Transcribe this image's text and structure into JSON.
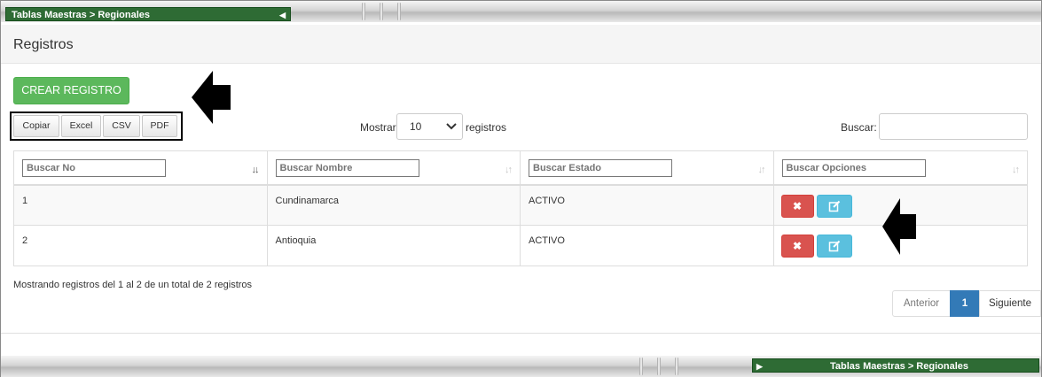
{
  "breadcrumb": {
    "text": "Tablas Maestras > Regionales"
  },
  "page": {
    "title": "Registros"
  },
  "toolbar": {
    "create_label": "CREAR REGISTRO"
  },
  "export_buttons": [
    {
      "label": "Copiar"
    },
    {
      "label": "Excel"
    },
    {
      "label": "CSV"
    },
    {
      "label": "PDF"
    }
  ],
  "length": {
    "prefix": "Mostrar",
    "selected": "10",
    "suffix": "registros"
  },
  "search": {
    "label": "Buscar:",
    "value": ""
  },
  "table": {
    "column_filters": [
      {
        "placeholder": "Buscar No"
      },
      {
        "placeholder": "Buscar Nombre"
      },
      {
        "placeholder": "Buscar Estado"
      },
      {
        "placeholder": "Buscar Opciones"
      }
    ],
    "rows": [
      {
        "no": "1",
        "nombre": "Cundinamarca",
        "estado": "ACTIVO"
      },
      {
        "no": "2",
        "nombre": "Antioquia",
        "estado": "ACTIVO"
      }
    ]
  },
  "info": {
    "text": "Mostrando registros del 1 al 2 de un total de 2 registros"
  },
  "pagination": {
    "prev": "Anterior",
    "current": "1",
    "next": "Siguiente"
  },
  "colors": {
    "accent_green": "#5cb85c",
    "danger": "#d9534f",
    "info": "#5bc0de",
    "primary": "#337ab7",
    "breadcrumb_bg": "#2e6b34"
  }
}
